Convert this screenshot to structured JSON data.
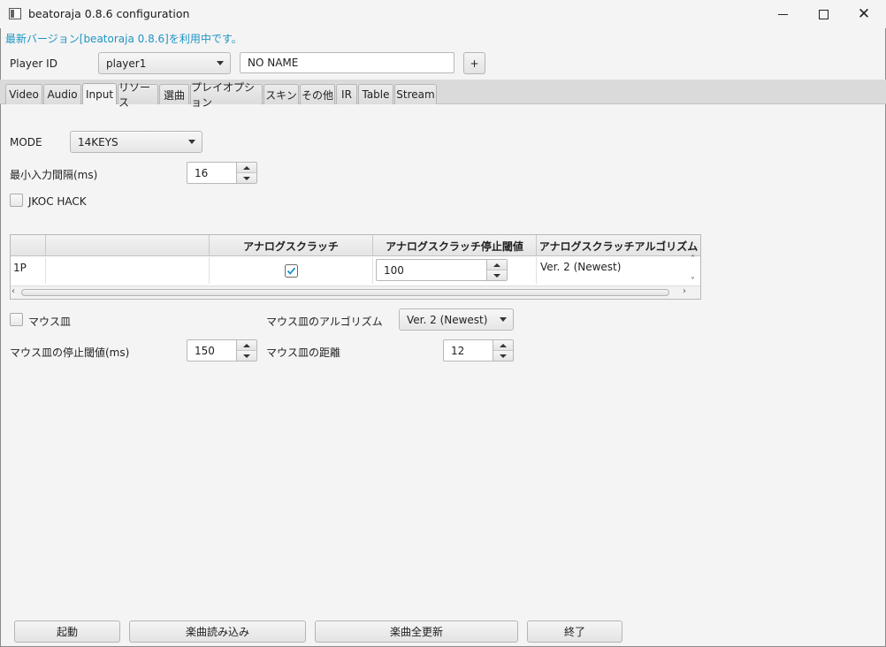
{
  "window": {
    "title": "beatoraja 0.8.6 configuration",
    "minimize_icon": "minimize-icon",
    "maximize_icon": "maximize-icon",
    "close_glyph": "✕"
  },
  "version_notice": "最新バージョン[beatoraja 0.8.6]を利用中です。",
  "player": {
    "label": "Player ID",
    "selected": "player1",
    "name_value": "NO NAME",
    "add_label": "+"
  },
  "tabs": [
    {
      "label": "Video"
    },
    {
      "label": "Audio"
    },
    {
      "label": "Input",
      "selected": true
    },
    {
      "label": "リソース"
    },
    {
      "label": "選曲"
    },
    {
      "label": "プレイオプション"
    },
    {
      "label": "スキン"
    },
    {
      "label": "その他"
    },
    {
      "label": "IR"
    },
    {
      "label": "Table"
    },
    {
      "label": "Stream"
    }
  ],
  "input": {
    "mode_label": "MODE",
    "mode_value": "14KEYS",
    "min_interval_label": "最小入力間隔(ms)",
    "min_interval_value": "16",
    "jkoc_label": "JKOC HACK",
    "jkoc_checked": false,
    "table": {
      "columns": [
        "",
        "",
        "アナログスクラッチ",
        "アナログスクラッチ停止閾値",
        "アナログスクラッチアルゴリズム"
      ],
      "rows": [
        {
          "player": "1P",
          "analog_scratch": true,
          "threshold": "100",
          "algorithm": "Ver. 2 (Newest)"
        }
      ]
    },
    "mouse_scratch_label": "マウス皿",
    "mouse_scratch_checked": false,
    "mouse_algorithm_label": "マウス皿のアルゴリズム",
    "mouse_algorithm_value": "Ver. 2 (Newest)",
    "mouse_threshold_label": "マウス皿の停止閾値(ms)",
    "mouse_threshold_value": "150",
    "mouse_distance_label": "マウス皿の距離",
    "mouse_distance_value": "12"
  },
  "bottom_buttons": {
    "launch": "起動",
    "load_songs": "楽曲読み込み",
    "update_all": "楽曲全更新",
    "exit": "終了"
  },
  "colors": {
    "notice": "#1e95c4",
    "checkmark": "#1a8fd1"
  }
}
